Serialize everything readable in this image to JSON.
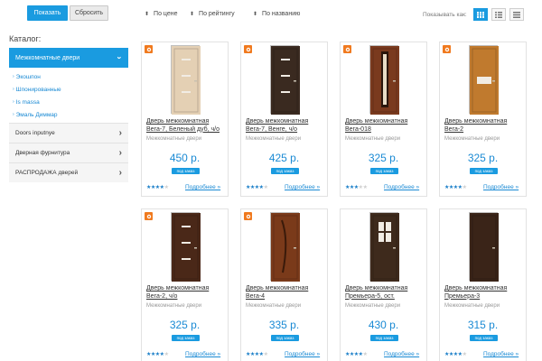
{
  "filter": {
    "show_label": "Показать",
    "reset_label": "Сбросить"
  },
  "catalog": {
    "title": "Каталог:",
    "active": "Межкомнатные двери",
    "subitems": [
      "Экошпон",
      "Шпонированные",
      "Is massa",
      "Эмаль Диммар"
    ],
    "items": [
      "Doors inputnye",
      "Дверная фурнитура",
      "РАСПРОДАЖА дверей"
    ]
  },
  "sort": {
    "options": [
      "По цене",
      "По рейтингу",
      "По названию"
    ],
    "view_label": "Показывать как:",
    "view_modes": [
      "grid-view-icon",
      "list-view-icon",
      "table-view-icon"
    ],
    "active_view": "grid-view-icon"
  },
  "products": [
    {
      "name": "Дверь межкомнатная Вега-7, Беленый дуб, ч/о",
      "category": "Межкомнатные двери",
      "price": "450 р.",
      "rating": 4,
      "hit": true,
      "door_color": "#e4d0b4",
      "glass": "strips"
    },
    {
      "name": "Дверь межкомнатная Вега-7, Венге, ч/о",
      "category": "Межкомнатные двери",
      "price": "425 р.",
      "rating": 4,
      "hit": true,
      "door_color": "#3a2a20",
      "glass": "strips"
    },
    {
      "name": "Дверь межкомнатная Вега-018",
      "category": "Межкомнатные двери",
      "price": "325 р.",
      "rating": 3,
      "hit": true,
      "door_color": "#7a3a1e",
      "glass": "column"
    },
    {
      "name": "Дверь межкомнатная Вега-2",
      "category": "Межкомнатные двери",
      "price": "325 р.",
      "rating": 4,
      "hit": true,
      "door_color": "#c07a2e",
      "glass": "bar"
    },
    {
      "name": "Дверь межкомнатная Вега-2, ч/о",
      "category": "Межкомнатные двери",
      "price": "325 р.",
      "rating": 4,
      "hit": true,
      "door_color": "#4a2818",
      "glass": "strips"
    },
    {
      "name": "Дверь межкомнатная Вега-4",
      "category": "Межкомнатные двери",
      "price": "335 р.",
      "rating": 4,
      "hit": true,
      "door_color": "#7a3a1a",
      "glass": "wave"
    },
    {
      "name": "Дверь межкомнатная Премьера-5, ост.",
      "category": "Межкомнатные двери",
      "price": "430 р.",
      "rating": 4,
      "hit": false,
      "door_color": "#3e2a1c",
      "glass": "panes"
    },
    {
      "name": "Дверь межкомнатная Премьера-3",
      "category": "Межкомнатные двери",
      "price": "315 р.",
      "rating": 4,
      "hit": false,
      "door_color": "#3a2418",
      "glass": "none"
    }
  ],
  "order_label": "под заказ",
  "more_label": "Подробнее »",
  "colors": {
    "accent": "#1a9be0",
    "hit_badge": "#f07a1f",
    "link": "#1a8ad4"
  }
}
